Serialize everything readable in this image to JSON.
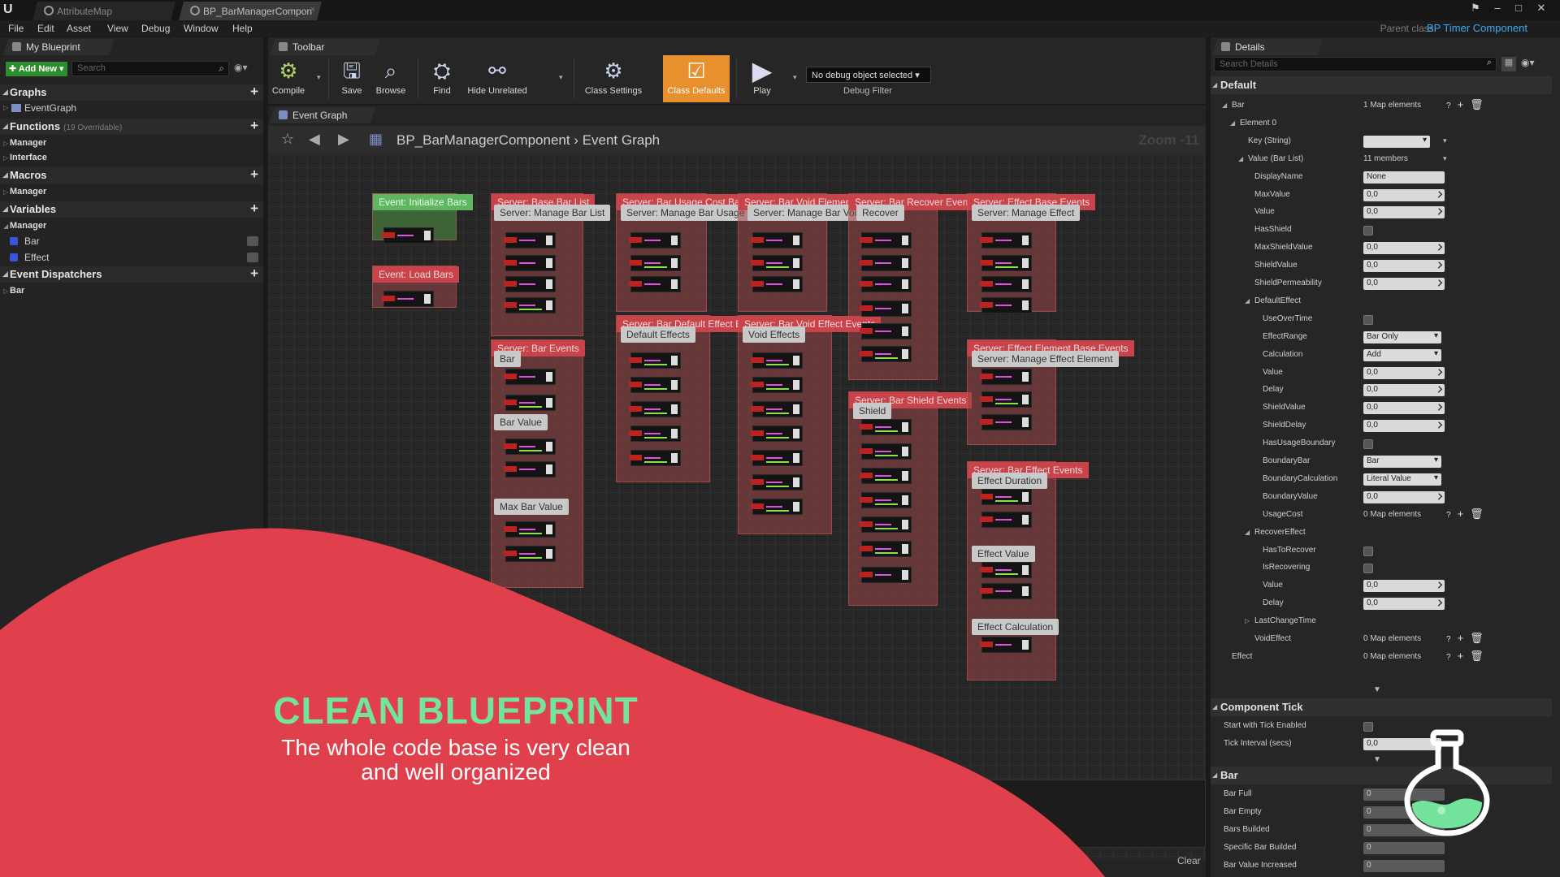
{
  "window": {
    "tabs": [
      "AttributeMap",
      "BP_BarManagerCompon"
    ],
    "parent_class_label": "Parent class:",
    "parent_class_value": "BP Timer Component"
  },
  "menu": [
    "File",
    "Edit",
    "Asset",
    "View",
    "Debug",
    "Window",
    "Help"
  ],
  "my_blueprint": {
    "tab": "My Blueprint",
    "add_new": "Add New",
    "search_placeholder": "Search",
    "graphs": {
      "title": "Graphs",
      "items": [
        "EventGraph"
      ]
    },
    "functions": {
      "title": "Functions",
      "sub": "(19 Overridable)",
      "items": [
        "Manager",
        "Interface"
      ]
    },
    "macros": {
      "title": "Macros",
      "items": [
        "Manager"
      ]
    },
    "variables": {
      "title": "Variables",
      "category": "Manager",
      "items": [
        "Bar",
        "Effect"
      ]
    },
    "event_dispatchers": {
      "title": "Event Dispatchers",
      "items": [
        "Bar"
      ]
    }
  },
  "toolbar": {
    "tab": "Toolbar",
    "buttons": [
      "Compile",
      "Save",
      "Browse",
      "Find",
      "Hide Unrelated",
      "Class Settings",
      "Class Defaults",
      "Play"
    ],
    "debug_select": "No debug object selected",
    "debug_label": "Debug Filter"
  },
  "graph": {
    "tab": "Event Graph",
    "breadcrumb_root": "BP_BarManagerComponent",
    "breadcrumb_leaf": "Event Graph",
    "zoom": "Zoom -11",
    "comments": {
      "init": "Event: Initialize Bars",
      "load": "Event: Load Bars",
      "base_bar_list": "Server: Base Bar List",
      "manage_bar_list": "Server: Manage Bar List",
      "usage_cost": "Server: Bar Usage Cost Base Events",
      "manage_usage": "Server: Manage Bar Usage Cost",
      "void_element": "Server: Bar Void Element Base Events",
      "manage_void": "Server: Manage Bar Void",
      "recover": "Server: Bar Recover Events",
      "recover_sub": "Recover",
      "effect_base": "Server: Effect Base Events",
      "manage_effect": "Server: Manage Effect",
      "bar_events": "Server: Bar Events",
      "bar_sub": "Bar",
      "bar_value": "Bar Value",
      "max_bar_value": "Max Bar Value",
      "default_effect": "Server: Bar Default Effect Events",
      "default_effects": "Default Effects",
      "void_effect": "Server: Bar Void Effect Events",
      "void_effects": "Void Effects",
      "shield_events": "Server: Bar Shield Events",
      "shield": "Shield",
      "effect_element": "Server: Effect Element Base Events",
      "manage_effect_element": "Server: Manage Effect Element",
      "bar_effect": "Server: Bar Effect Events",
      "effect_duration": "Effect Duration",
      "effect_value": "Effect Value",
      "effect_calculation": "Effect Calculation"
    },
    "watermark": "EPRINT",
    "clear": "Clear"
  },
  "details": {
    "tab": "Details",
    "search_placeholder": "Search Details",
    "default_cat": "Default",
    "rows": [
      {
        "name": "Bar",
        "indent": 1,
        "tri": "open",
        "text": "1 Map elements",
        "icons": true
      },
      {
        "name": "Element 0",
        "indent": 2,
        "tri": "open"
      },
      {
        "name": "Key (String)",
        "indent": 3,
        "combo": "",
        "arrow": true
      },
      {
        "name": "Value (Bar List)",
        "indent": 3,
        "tri": "open",
        "text": "11 members"
      },
      {
        "name": "DisplayName",
        "indent": 4,
        "value": "None"
      },
      {
        "name": "MaxValue",
        "indent": 4,
        "value": "0,0",
        "spin": true
      },
      {
        "name": "Value",
        "indent": 4,
        "value": "0,0",
        "spin": true
      },
      {
        "name": "HasShield",
        "indent": 4,
        "check": true
      },
      {
        "name": "MaxShieldValue",
        "indent": 4,
        "value": "0,0",
        "spin": true
      },
      {
        "name": "ShieldValue",
        "indent": 4,
        "value": "0,0",
        "spin": true
      },
      {
        "name": "ShieldPermeability",
        "indent": 4,
        "value": "0,0",
        "spin": true
      },
      {
        "name": "DefaultEffect",
        "indent": 4,
        "tri": "open"
      },
      {
        "name": "UseOverTime",
        "indent": 5,
        "check": true
      },
      {
        "name": "EffectRange",
        "indent": 5,
        "combo": "Bar Only"
      },
      {
        "name": "Calculation",
        "indent": 5,
        "combo": "Add"
      },
      {
        "name": "Value",
        "indent": 5,
        "value": "0,0",
        "spin": true
      },
      {
        "name": "Delay",
        "indent": 5,
        "value": "0,0",
        "spin": true
      },
      {
        "name": "ShieldValue",
        "indent": 5,
        "value": "0,0",
        "spin": true
      },
      {
        "name": "ShieldDelay",
        "indent": 5,
        "value": "0,0",
        "spin": true
      },
      {
        "name": "HasUsageBoundary",
        "indent": 5,
        "check": true
      },
      {
        "name": "BoundaryBar",
        "indent": 5,
        "combo": "Bar"
      },
      {
        "name": "BoundaryCalculation",
        "indent": 5,
        "combo": "Literal Value"
      },
      {
        "name": "BoundaryValue",
        "indent": 5,
        "value": "0,0",
        "spin": true
      },
      {
        "name": "UsageCost",
        "indent": 5,
        "text": "0 Map elements",
        "icons": true
      },
      {
        "name": "RecoverEffect",
        "indent": 4,
        "tri": "open"
      },
      {
        "name": "HasToRecover",
        "indent": 5,
        "check": true
      },
      {
        "name": "IsRecovering",
        "indent": 5,
        "check": true
      },
      {
        "name": "Value",
        "indent": 5,
        "value": "0,0",
        "spin": true
      },
      {
        "name": "Delay",
        "indent": 5,
        "value": "0,0",
        "spin": true
      },
      {
        "name": "LastChangeTime",
        "indent": 4,
        "tri": "closed"
      },
      {
        "name": "VoidEffect",
        "indent": 4,
        "text": "0 Map elements",
        "icons": true
      },
      {
        "name": "Effect",
        "indent": 1,
        "text": "0 Map elements",
        "icons": true
      }
    ],
    "component_tick_cat": "Component Tick",
    "tick_rows": [
      {
        "name": "Start with Tick Enabled",
        "check": true
      },
      {
        "name": "Tick Interval (secs)",
        "value": "0,0",
        "spin": true
      }
    ],
    "bar_cat": "Bar",
    "bar_rows": [
      {
        "name": "Bar Full",
        "value": "0"
      },
      {
        "name": "Bar Empty",
        "value": "0"
      },
      {
        "name": "Bars Builded",
        "value": "0"
      },
      {
        "name": "Specific Bar Builded",
        "value": "0"
      },
      {
        "name": "Bar Value Increased",
        "value": "0"
      }
    ]
  },
  "promo": {
    "title": "CLEAN BLUEPRINT",
    "line1": "The whole code base is very clean",
    "line2": "and well organized"
  },
  "colors": {
    "accent_red": "#e0404b",
    "accent_green": "#74e39e",
    "class_defaults": "#e8902e",
    "link_blue": "#3aa8f0"
  }
}
